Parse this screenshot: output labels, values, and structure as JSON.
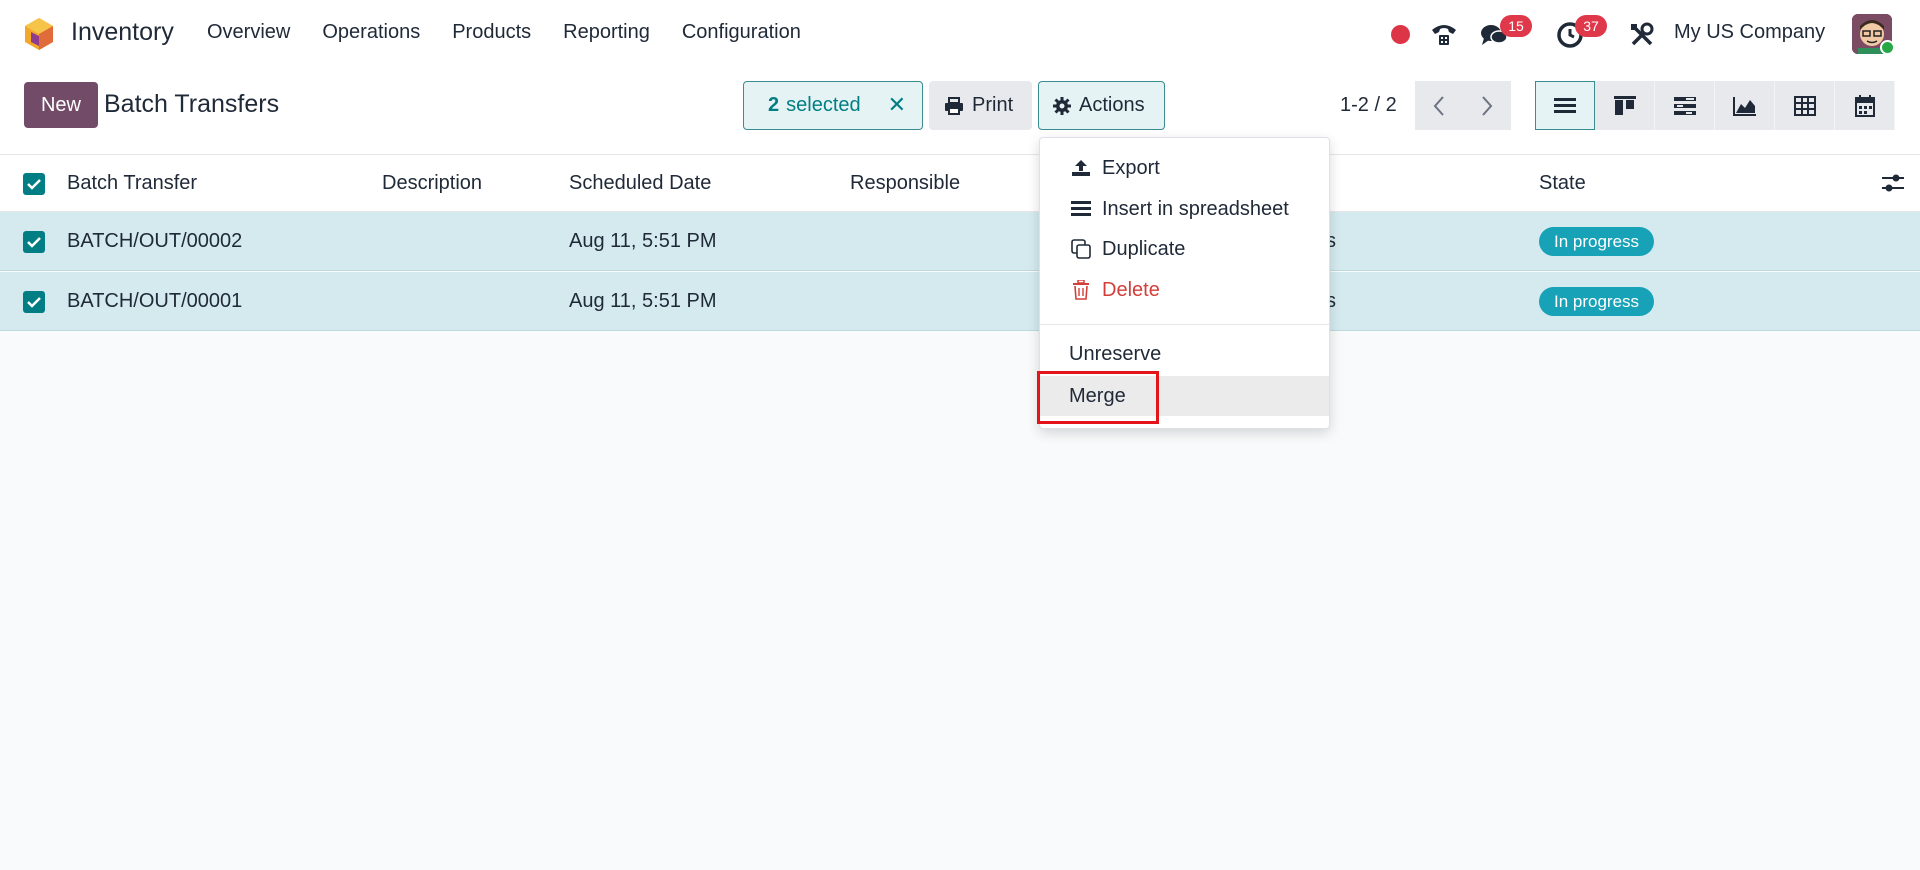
{
  "navbar": {
    "app_name": "Inventory",
    "menu": [
      "Overview",
      "Operations",
      "Products",
      "Reporting",
      "Configuration"
    ],
    "messages_badge": "15",
    "activities_badge": "37",
    "company": "My US Company"
  },
  "control": {
    "new_label": "New",
    "title": "Batch Transfers",
    "selected_count": "2",
    "selected_label": "selected",
    "print_label": "Print",
    "actions_label": "Actions",
    "pager": "1-2 / 2"
  },
  "table": {
    "headers": {
      "batch_transfer": "Batch Transfer",
      "description": "Description",
      "scheduled_date": "Scheduled Date",
      "responsible": "Responsible",
      "state": "State"
    },
    "rows": [
      {
        "name": "BATCH/OUT/00002",
        "description": "",
        "scheduled_date": "Aug 11, 5:51 PM",
        "responsible": "",
        "partial": "s",
        "state": "In progress"
      },
      {
        "name": "BATCH/OUT/00001",
        "description": "",
        "scheduled_date": "Aug 11, 5:51 PM",
        "responsible": "",
        "partial": "s",
        "state": "In progress"
      }
    ]
  },
  "actions_menu": {
    "export": "Export",
    "insert": "Insert in spreadsheet",
    "duplicate": "Duplicate",
    "delete": "Delete",
    "unreserve": "Unreserve",
    "merge": "Merge"
  },
  "colors": {
    "brand": "#714b67",
    "accent": "#017e84",
    "selected_row": "#d4eaee",
    "badge": "#e0384b",
    "danger": "#d23f3a",
    "state_badge": "#17a2b8",
    "highlight": "#e3151a"
  }
}
